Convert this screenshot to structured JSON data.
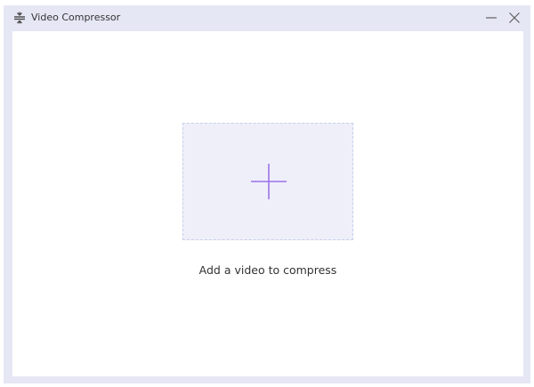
{
  "window": {
    "title": "Video Compressor",
    "icons": {
      "app": "compress-icon",
      "minimize": "minimize-icon",
      "close": "close-icon"
    }
  },
  "main": {
    "dropzone_icon": "plus-icon",
    "hint": "Add a video to compress"
  },
  "colors": {
    "frame": "#e6e7f5",
    "dropzone_bg": "#efeffa",
    "dropzone_border": "#c6d1e8",
    "accent": "#9b72e8"
  }
}
